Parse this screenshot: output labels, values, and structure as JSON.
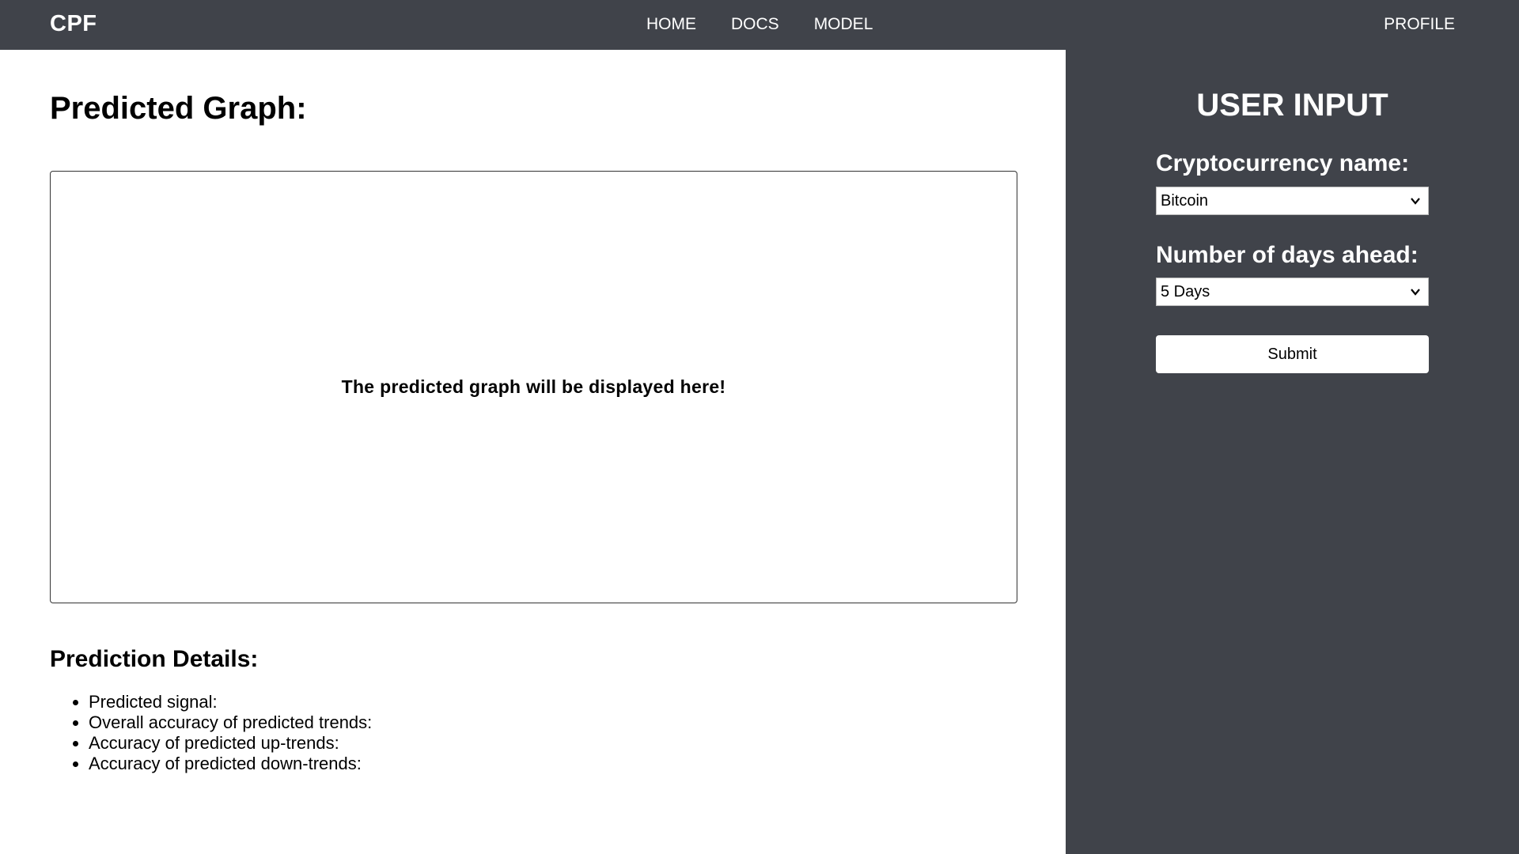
{
  "nav": {
    "brand": "CPF",
    "links": [
      "HOME",
      "DOCS",
      "MODEL"
    ],
    "profile": "PROFILE"
  },
  "main": {
    "title": "Predicted Graph:",
    "graph_placeholder": "The predicted graph will be displayed here!",
    "details_title": "Prediction Details:",
    "details": [
      "Predicted signal:",
      "Overall accuracy of predicted trends:",
      "Accuracy of predicted up-trends:",
      "Accuracy of predicted down-trends:"
    ]
  },
  "sidebar": {
    "title": "USER INPUT",
    "crypto_label": "Cryptocurrency name:",
    "crypto_value": "Bitcoin",
    "days_label": "Number of days ahead:",
    "days_value": "5 Days",
    "submit_label": "Submit"
  },
  "colors": {
    "dark_panel": "#40434a",
    "text_light": "#ffffff"
  }
}
